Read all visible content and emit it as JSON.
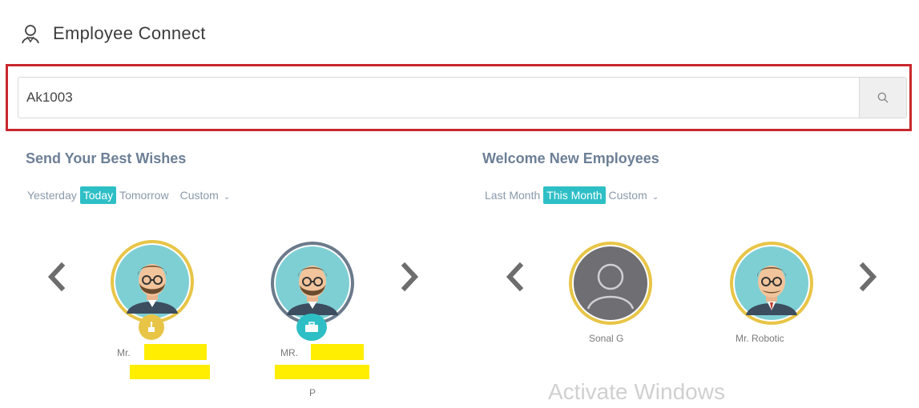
{
  "header": {
    "title": "Employee Connect",
    "icon": "user-icon"
  },
  "search": {
    "value": "Ak1003",
    "icon": "search-icon"
  },
  "wishes": {
    "title": "Send Your Best Wishes",
    "filters": [
      "Yesterday",
      "Today",
      "Tomorrow",
      "Custom"
    ],
    "active_filter": "Today",
    "people": [
      {
        "name_prefix": "Mr.",
        "badge": "birthday-icon",
        "ring_color": "#e8c547"
      },
      {
        "name_prefix": "MR.",
        "name_suffix": "P",
        "badge": "work-anniversary-icon",
        "ring_color": "#6b7b8c"
      }
    ]
  },
  "new_employees": {
    "title": "Welcome New Employees",
    "filters": [
      "Last Month",
      "This Month",
      "Custom"
    ],
    "active_filter": "This Month",
    "people": [
      {
        "name": "Sonal G",
        "ring_color": "#e8c547"
      },
      {
        "name": "Mr. Robotic",
        "ring_color": "#e8c547"
      }
    ]
  },
  "watermark": "Activate Windows",
  "colors": {
    "accent": "#2ebfc6",
    "highlight_border": "#c8282d",
    "section_title": "#6c7f96"
  }
}
